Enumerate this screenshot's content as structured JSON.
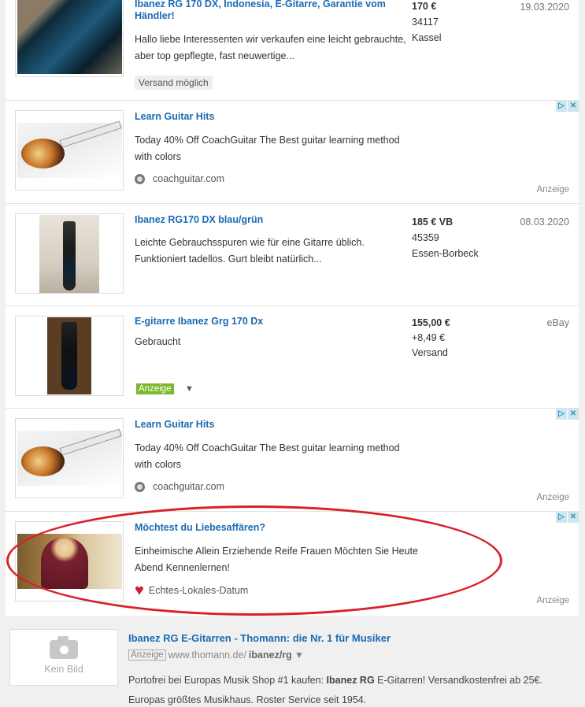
{
  "listings": [
    {
      "title": "Ibanez RG 170 DX, Indonesia, E-Gitarre, Garantie vom Händler!",
      "desc": "Hallo liebe Interessenten wir verkaufen eine leicht gebrauchte, aber top gepflegte, fast neuwertige...",
      "price": "170 €",
      "zip": "34117",
      "city": "Kassel",
      "date": "19.03.2020",
      "tag": "Versand möglich"
    },
    {
      "title": "Ibanez RG170 DX blau/grün",
      "desc": "Leichte Gebrauchsspuren wie für eine Gitarre üblich. Funktioniert tadellos. Gurt bleibt natürlich...",
      "price": "185 € VB",
      "zip": "45359",
      "city": "Essen-Borbeck",
      "date": "08.03.2020"
    },
    {
      "title": "E-gitarre Ibanez Grg 170 Dx",
      "desc": "Gebraucht",
      "price": "155,00 €",
      "shipping": "+8,49 €",
      "shipping_label": "Versand",
      "source": "eBay",
      "anzeige": "Anzeige",
      "dropdown": "▼"
    }
  ],
  "ads": [
    {
      "title": "Learn Guitar Hits",
      "desc": "Today 40% Off CoachGuitar The Best guitar learning method with colors",
      "site": "coachguitar.com",
      "label": "Anzeige"
    },
    {
      "title": "Learn Guitar Hits",
      "desc": "Today 40% Off CoachGuitar The Best guitar learning method with colors",
      "site": "coachguitar.com",
      "label": "Anzeige"
    },
    {
      "title": "Möchtest du Liebesaffären?",
      "desc": "Einheimische Allein Erziehende Reife Frauen Möchten Sie Heute Abend Kennenlernen!",
      "site": "Echtes-Lokales-Datum",
      "label": "Anzeige"
    }
  ],
  "adchoices": {
    "info": "▷",
    "close": "✕"
  },
  "external": {
    "no_image": "Kein Bild",
    "title": "Ibanez RG E-Gitarren - Thomann: die Nr. 1 für Musiker",
    "anzeige": "Anzeige",
    "url_prefix": "www.thomann.de/",
    "url_bold": "ibanez/rg",
    "url_arrow": "▼",
    "desc_1": "Portofrei bei Europas Musik Shop #1 kaufen: ",
    "desc_bold_1": "Ibanez RG",
    "desc_2": " E-Gitarren! Versandkostenfrei ab 25€.",
    "desc_line2": "Europas größtes Musikhaus. Roster Service seit 1954."
  },
  "colors": {
    "link": "#1a6ab2",
    "highlight_ellipse": "#d9202b",
    "anzeige_green": "#7cb82f"
  }
}
